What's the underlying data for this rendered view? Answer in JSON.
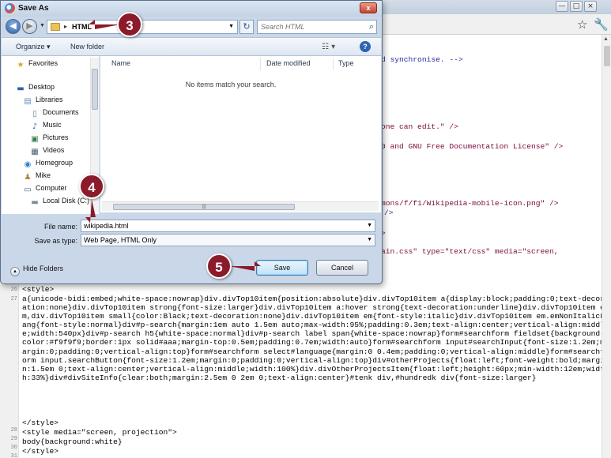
{
  "background_window": {
    "title_buttons": [
      "—",
      "□",
      "×"
    ],
    "toolbar_icons": [
      "star-icon",
      "wrench-icon"
    ],
    "code_fragments": [
      {
        "text": "d synchronise. -->",
        "class": "blue"
      },
      {
        "text": "one can edit.\" />",
        "class": "maroon"
      },
      {
        "text": "0 and GNU Free Documentation License\" />",
        "class": "maroon"
      },
      {
        "text": "mons/f/f1/Wikipedia-mobile-icon.png\" />",
        "class": "maroon"
      },
      {
        "text": "/>",
        "class": "blue"
      },
      {
        "text": ">",
        "class": "blue"
      },
      {
        "text": "ain.css\" type=\"text/css\" media=\"screen,",
        "class": "maroon"
      }
    ],
    "code_lines": [
      {
        "num": "26",
        "text": "<style>"
      },
      {
        "num": "27",
        "text": "a{unicode-bidi:embed;white-space:nowrap}div.divTop10item{position:absolute}div.divTop10item a{display:block;padding:0;text-decoration:none}div.divTop10item strong{font-size:larger}div.divTop10item a:hover strong{text-decoration:underline}div.divTop10item em,div.divTop10item small{color:Black;text-decoration:none}div.divTop10item em{font-style:italic}div.divTop10item em.emNonItalicLang{font-style:normal}div#p-search{margin:1em auto 1.5em auto;max-width:95%;padding:0.3em;text-align:center;vertical-align:middle;width:540px}div#p-search h5{white-space:normal}div#p-search label span{white-space:nowrap}form#searchform fieldset{background-color:#f9f9f9;border:1px solid#aaa;margin-top:0.5em;padding:0.7em;width:auto}form#searchform input#searchInput{font-size:1.2em;margin:0;padding:0;vertical-align:top}form#searchform select#language{margin:0 0.4em;padding:0;vertical-align:middle}form#searchform input.searchButton{font-size:1.2em;margin:0;padding:0;vertical-align:top}div#otherProjects{float:left;font-weight:bold;margin:1.5em 0;text-align:center;vertical-align:middle;width:100%}div.divOtherProjectsItem{float:left;height:60px;min-width:12em;width:33%}div#divSiteInfo{clear:both;margin:2.5em 0 2em 0;text-align:center}#tenk div,#hundredk div{font-size:larger}"
      },
      {
        "num": "28",
        "text": "</style>"
      },
      {
        "num": "29",
        "text": "<style media=\"screen, projection\">"
      },
      {
        "num": "30",
        "text": "body{background:white}"
      },
      {
        "num": "31",
        "text": "</style>"
      }
    ]
  },
  "dialog": {
    "title": "Save As",
    "close_label": "x",
    "address": {
      "path": "HTML",
      "separator": "▸"
    },
    "search_placeholder": "Search HTML",
    "commands": {
      "organize": "Organize ▾",
      "new_folder": "New folder"
    },
    "nav_items": [
      {
        "label": "Favorites",
        "icon": "star-icon",
        "glyph": "★",
        "color": "#d7a72a",
        "indent": 0
      },
      {
        "label": "Desktop",
        "icon": "desktop-icon",
        "glyph": "▬",
        "color": "#2c5fa8",
        "indent": 0
      },
      {
        "label": "Libraries",
        "icon": "libraries-icon",
        "glyph": "▤",
        "color": "#6a8fbf",
        "indent": 1
      },
      {
        "label": "Documents",
        "icon": "documents-icon",
        "glyph": "▯",
        "color": "#6d7a8c",
        "indent": 2
      },
      {
        "label": "Music",
        "icon": "music-icon",
        "glyph": "♪",
        "color": "#2a6ab4",
        "indent": 2
      },
      {
        "label": "Pictures",
        "icon": "pictures-icon",
        "glyph": "▣",
        "color": "#3d7f4a",
        "indent": 2
      },
      {
        "label": "Videos",
        "icon": "videos-icon",
        "glyph": "▦",
        "color": "#4b5a70",
        "indent": 2
      },
      {
        "label": "Homegroup",
        "icon": "homegroup-icon",
        "glyph": "◉",
        "color": "#2f7fc8",
        "indent": 1
      },
      {
        "label": "Mike",
        "icon": "user-icon",
        "glyph": "♟",
        "color": "#b58a3c",
        "indent": 1
      },
      {
        "label": "Computer",
        "icon": "computer-icon",
        "glyph": "▭",
        "color": "#3c5e8c",
        "indent": 1
      },
      {
        "label": "Local Disk (C:)",
        "icon": "disk-icon",
        "glyph": "▬",
        "color": "#7c8a9c",
        "indent": 2
      }
    ],
    "columns": [
      "Name",
      "Date modified",
      "Type"
    ],
    "empty_message": "No items match your search.",
    "file_name_label": "File name:",
    "file_name_value": "wikipedia.html",
    "save_type_label": "Save as type:",
    "save_type_value": "Web Page, HTML Only",
    "hide_folders_label": "Hide Folders",
    "save_label": "Save",
    "cancel_label": "Cancel"
  },
  "callouts": [
    {
      "number": "3"
    },
    {
      "number": "4"
    },
    {
      "number": "5"
    }
  ],
  "colors": {
    "callout": "#8b1a2b",
    "dialog_bg": "#c9d7e8",
    "code_blue": "#2a2aa0",
    "code_maroon": "#7b0a3c"
  }
}
